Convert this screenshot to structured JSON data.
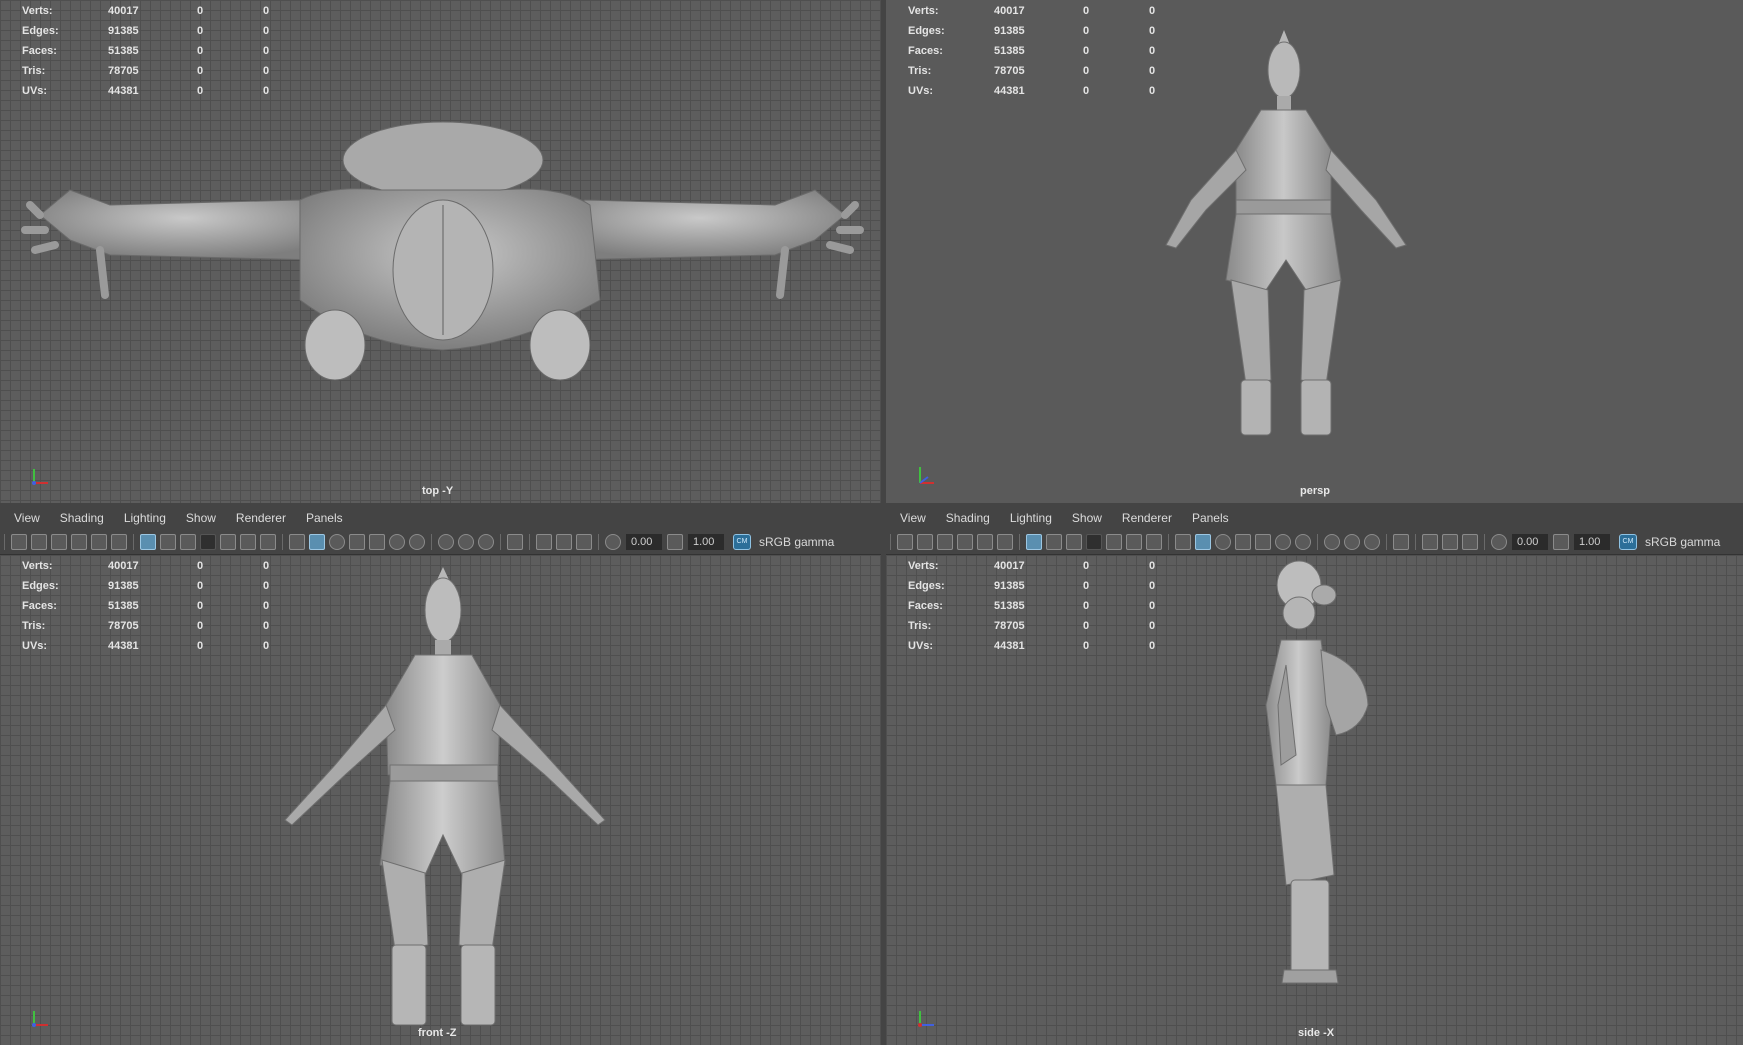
{
  "hud": {
    "rows": [
      {
        "label": "Verts:",
        "value": "40017",
        "c1": "0",
        "c2": "0"
      },
      {
        "label": "Edges:",
        "value": "91385",
        "c1": "0",
        "c2": "0"
      },
      {
        "label": "Faces:",
        "value": "51385",
        "c1": "0",
        "c2": "0"
      },
      {
        "label": "Tris:",
        "value": "78705",
        "c1": "0",
        "c2": "0"
      },
      {
        "label": "UVs:",
        "value": "44381",
        "c1": "0",
        "c2": "0"
      }
    ]
  },
  "panels": {
    "top": {
      "camera": "top -Y"
    },
    "persp": {
      "camera": "persp"
    },
    "front": {
      "camera": "front -Z"
    },
    "side": {
      "camera": "side -X"
    }
  },
  "menu": {
    "items": [
      "View",
      "Shading",
      "Lighting",
      "Show",
      "Renderer",
      "Panels"
    ]
  },
  "toolbar": {
    "field_a": "0.00",
    "field_b": "1.00",
    "color_space": "sRGB gamma",
    "color_mgmt_icon_text": "CM"
  },
  "icons": {
    "toolbar": [
      "select-camera-icon",
      "camera-attributes-icon",
      "bookmarks-icon",
      "image-plane-icon",
      "2d-pan-zoom-icon",
      "grease-pencil-icon",
      "grid-icon",
      "film-gate-icon",
      "resolution-gate-icon",
      "gate-mask-icon",
      "field-chart-icon",
      "safe-action-icon",
      "safe-title-icon",
      "wireframe-icon",
      "smooth-shade-icon",
      "default-material-icon",
      "textured-icon",
      "use-all-lights-icon",
      "shadows-icon",
      "screen-space-ao-icon",
      "motion-blur-icon",
      "anti-aliasing-icon",
      "depth-of-field-icon",
      "isolate-select-icon",
      "xray-icon",
      "xray-joints-icon",
      "xray-active-icon",
      "backface-culling-icon",
      "exposure-icon",
      "gamma-icon",
      "color-management-icon"
    ]
  },
  "colors": {
    "viewport_bg": "#5d5d5d",
    "grid_line": "#4f4f4f",
    "ui_bg": "#444444",
    "accent_active": "#5a8fb0",
    "axis_x": "#d03030",
    "axis_y": "#40c040",
    "axis_z": "#4060e0"
  }
}
